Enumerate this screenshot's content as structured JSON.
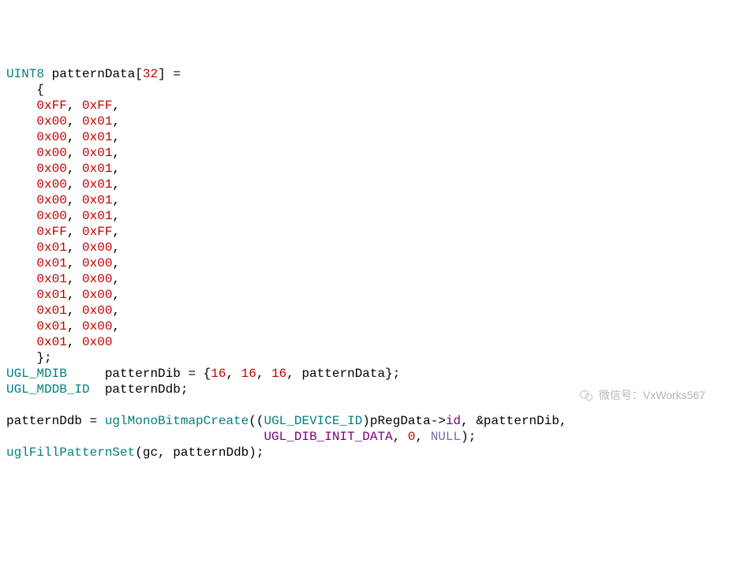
{
  "decl": {
    "type": "UINT8",
    "name": "patternData",
    "size": "32",
    "rows": [
      [
        "0xFF",
        "0xFF"
      ],
      [
        "0x00",
        "0x01"
      ],
      [
        "0x00",
        "0x01"
      ],
      [
        "0x00",
        "0x01"
      ],
      [
        "0x00",
        "0x01"
      ],
      [
        "0x00",
        "0x01"
      ],
      [
        "0x00",
        "0x01"
      ],
      [
        "0x00",
        "0x01"
      ],
      [
        "0xFF",
        "0xFF"
      ],
      [
        "0x01",
        "0x00"
      ],
      [
        "0x01",
        "0x00"
      ],
      [
        "0x01",
        "0x00"
      ],
      [
        "0x01",
        "0x00"
      ],
      [
        "0x01",
        "0x00"
      ],
      [
        "0x01",
        "0x00"
      ],
      [
        "0x01",
        "0x00"
      ]
    ]
  },
  "dib": {
    "type": "UGL_MDIB",
    "name": "patternDib",
    "vals": [
      "16",
      "16",
      "16",
      "patternData"
    ]
  },
  "ddb": {
    "type": "UGL_MDDB_ID",
    "name": "patternDdb"
  },
  "call1": {
    "lhs": "patternDdb",
    "fn": "uglMonoBitmapCreate",
    "cast": "UGL_DEVICE_ID",
    "arg1_obj": "pRegData",
    "arg1_mem": "id",
    "arg2": "&patternDib",
    "line2_enum": "UGL_DIB_INIT_DATA",
    "line2_zero": "0",
    "line2_null": "NULL"
  },
  "call2": {
    "fn": "uglFillPatternSet",
    "arg1": "gc",
    "arg2": "patternDdb"
  },
  "watermark": "微信号：VxWorks567"
}
